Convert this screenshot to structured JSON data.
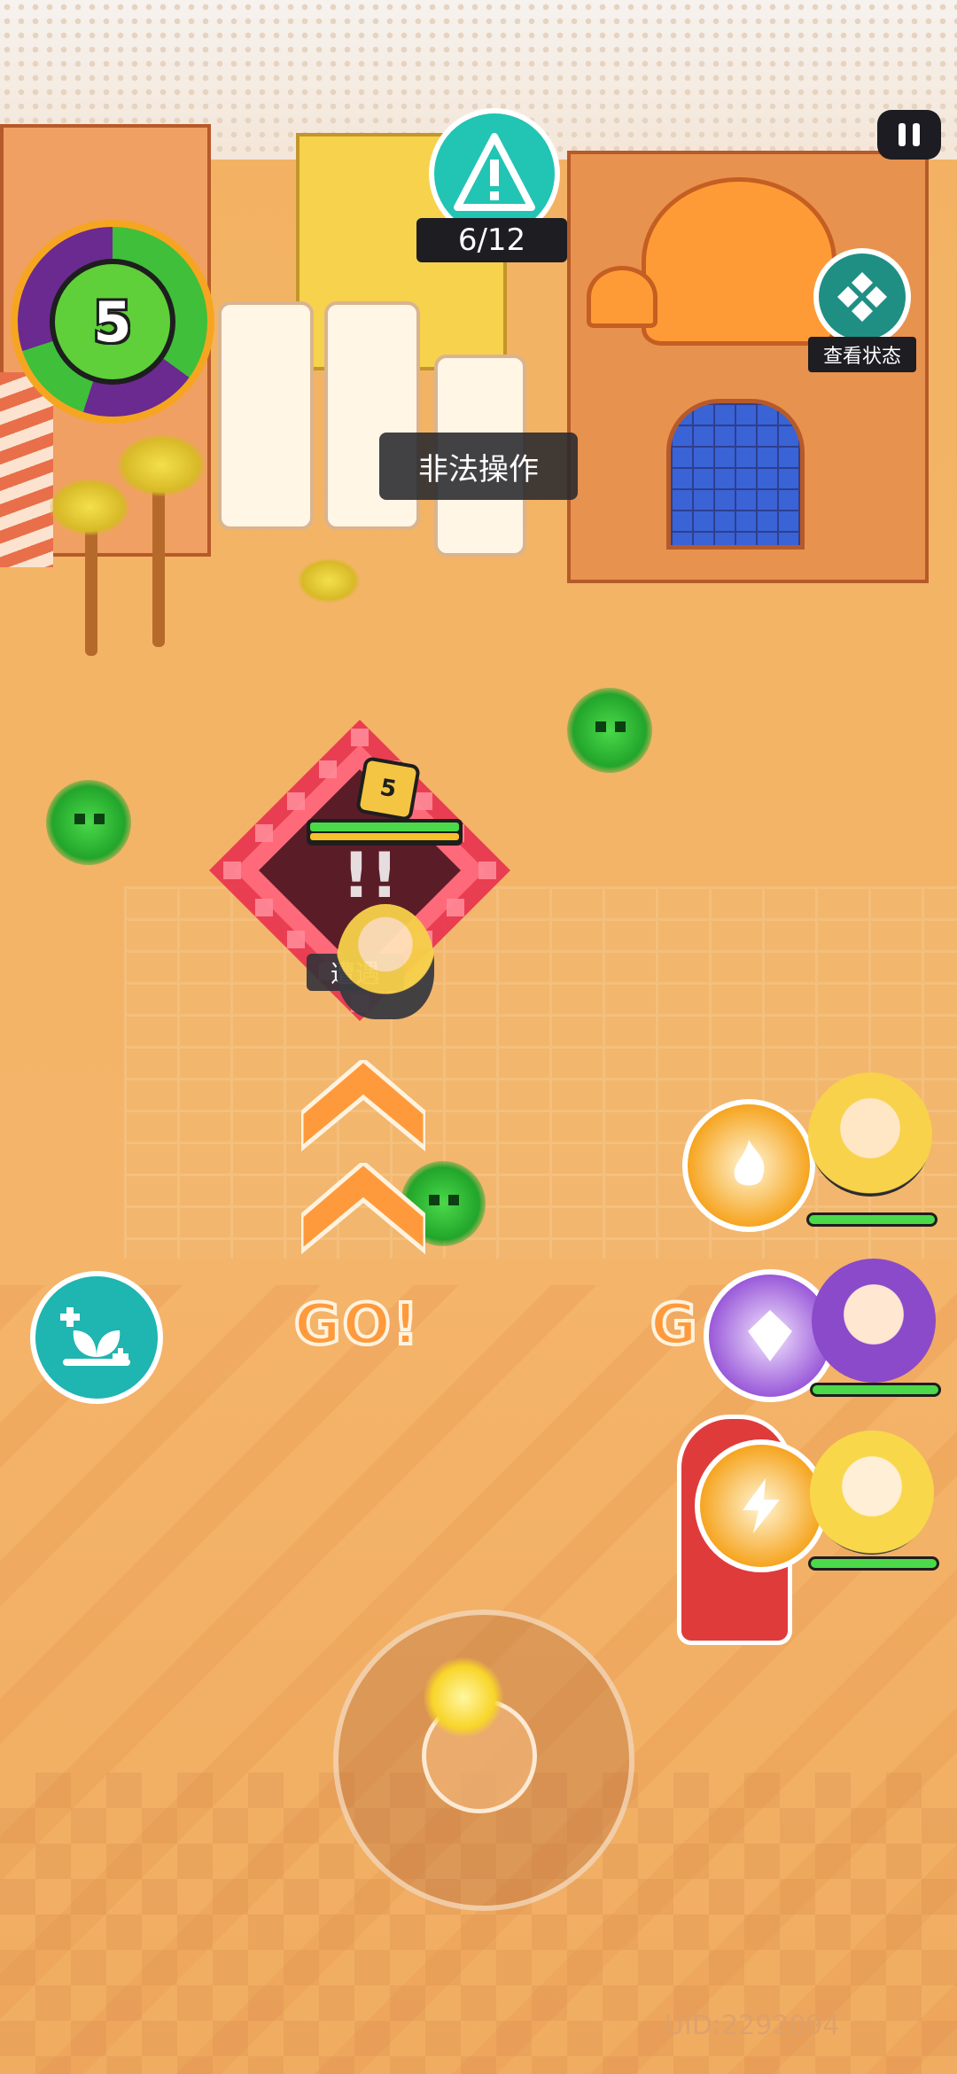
{
  "hud": {
    "level": "5",
    "quest_counter": "6/12",
    "status_label": "查看状态",
    "illegal_banner": "非法操作",
    "pause_icon": "pause-icon",
    "quest_icon": "alert-icon",
    "status_icon": "grid-diamond-icon",
    "heal_icon": "sprout-heal-icon"
  },
  "encounter": {
    "enemy_level": "5",
    "label": "遭遇",
    "enemy_hp_fraction": 1.0
  },
  "prompts": {
    "go_left": "GO!",
    "go_right": "G"
  },
  "party": [
    {
      "name": "",
      "skill_color": "#f6a521",
      "hp_fraction": 1.0
    },
    {
      "name": "",
      "skill_color": "#9a5ad9",
      "hp_fraction": 1.0
    },
    {
      "name": "",
      "skill_color": "#f6a521",
      "hp_fraction": 1.0
    }
  ],
  "footer": {
    "uid": "UID:2292094"
  },
  "colors": {
    "ground": "#f3b466",
    "accent_teal": "#22c4b4",
    "hp_green": "#4bd94a",
    "encounter_red": "#e8344f"
  }
}
